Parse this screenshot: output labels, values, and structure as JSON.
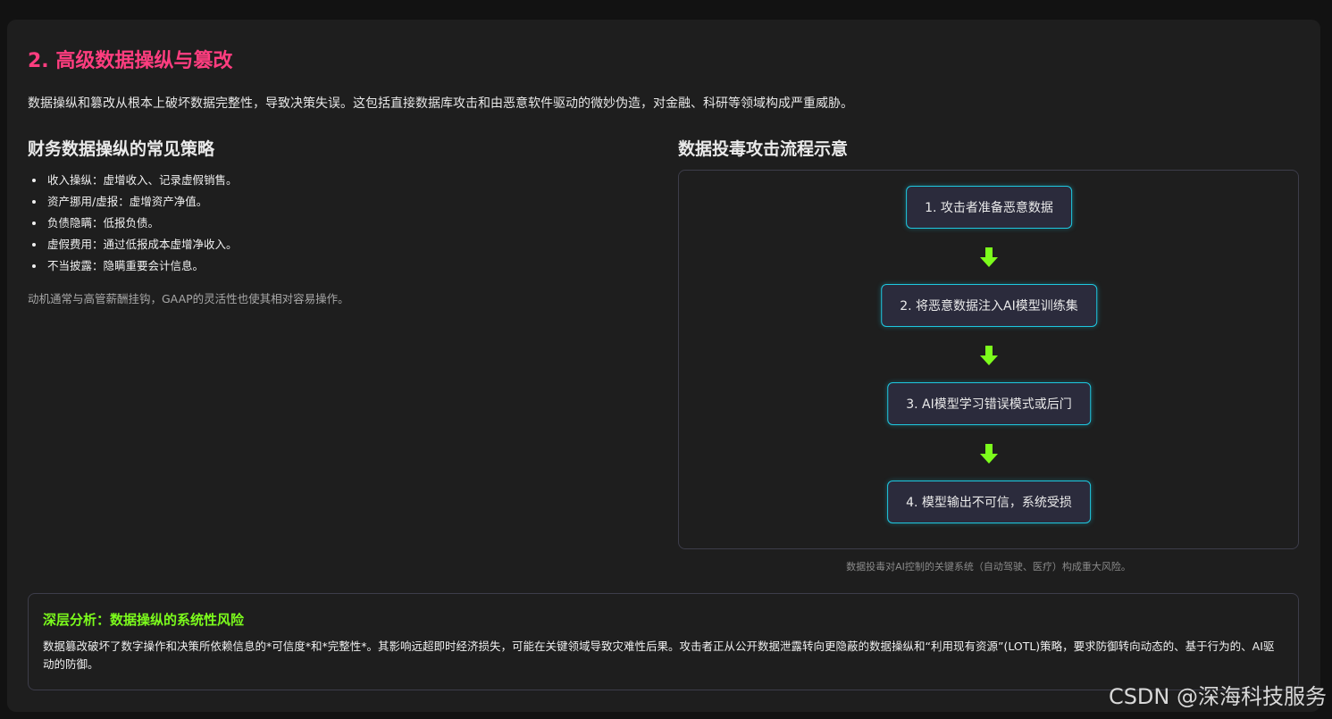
{
  "section": {
    "title": "2. 高级数据操纵与篡改",
    "intro": "数据操纵和篡改从根本上破坏数据完整性，导致决策失误。这包括直接数据库攻击和由恶意软件驱动的微妙伪造，对金融、科研等领域构成严重威胁。"
  },
  "strategies": {
    "heading": "财务数据操纵的常见策略",
    "items": [
      "收入操纵：虚增收入、记录虚假销售。",
      "资产挪用/虚报：虚增资产净值。",
      "负债隐瞒：低报负债。",
      "虚假费用：通过低报成本虚增净收入。",
      "不当披露：隐瞒重要会计信息。"
    ],
    "note": "动机通常与高管薪酬挂钩，GAAP的灵活性也使其相对容易操作。"
  },
  "flow": {
    "heading": "数据投毒攻击流程示意",
    "steps": [
      "1. 攻击者准备恶意数据",
      "2. 将恶意数据注入AI模型训练集",
      "3. AI模型学习错误模式或后门",
      "4. 模型输出不可信，系统受损"
    ],
    "caption": "数据投毒对AI控制的关键系统（自动驾驶、医疗）构成重大风险。"
  },
  "analysis": {
    "heading": "深层分析：数据操纵的系统性风险",
    "body": "数据篡改破坏了数字操作和决策所依赖信息的*可信度*和*完整性*。其影响远超即时经济损失，可能在关键领域导致灾难性后果。攻击者正从公开数据泄露转向更隐蔽的数据操纵和“利用现有资源”(LOTL)策略，要求防御转向动态的、基于行为的、AI驱动的防御。"
  },
  "watermark": "CSDN @深海科技服务",
  "colors": {
    "title": "#ff3d7f",
    "accent_green": "#7cfc1c",
    "step_border": "#1ec8e0",
    "card_bg": "#1e1e1e"
  }
}
